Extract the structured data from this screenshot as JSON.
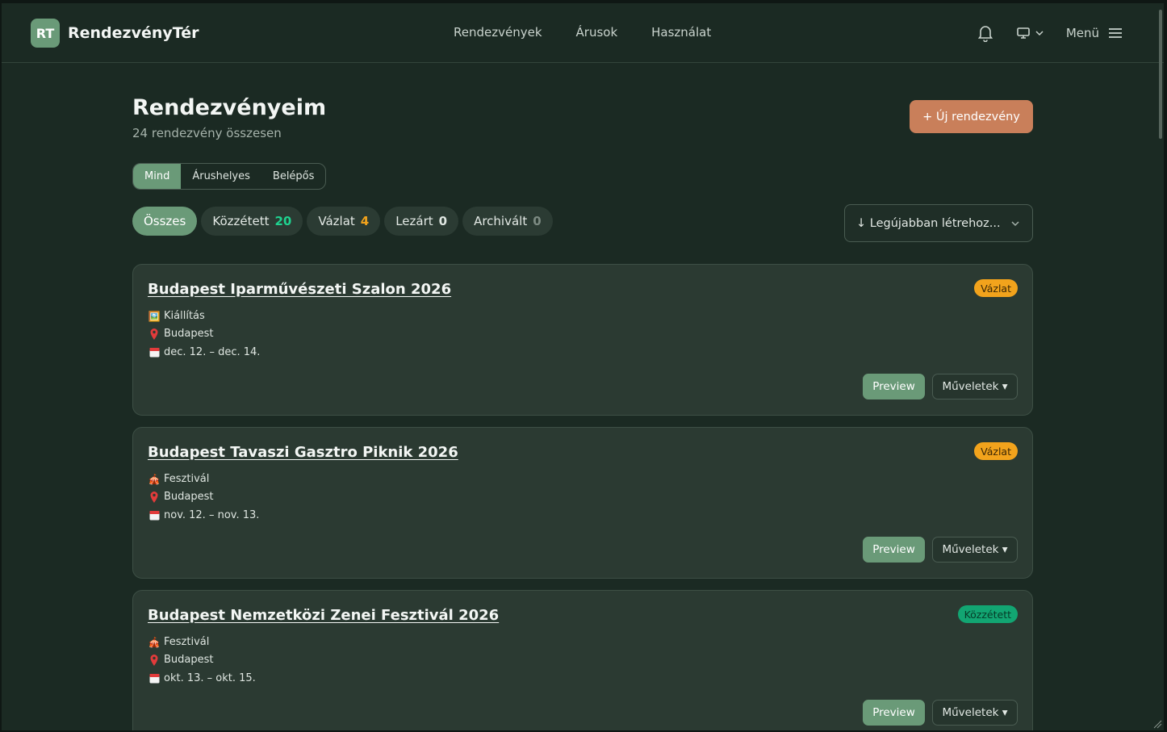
{
  "app": {
    "logo_badge": "RT",
    "name": "RendezvényTér"
  },
  "nav": [
    "Rendezvények",
    "Árusok",
    "Használat"
  ],
  "header": {
    "menu_label": "Menü"
  },
  "page": {
    "title": "Rendezvényeim",
    "subtitle": "24 rendezvény összesen",
    "new_button": "+ Új rendezvény"
  },
  "segments": [
    "Mind",
    "Árushelyes",
    "Belépős"
  ],
  "filters": [
    {
      "label": "Összes",
      "count": "",
      "color": ""
    },
    {
      "label": "Közzétett",
      "count": "20",
      "color": "#1fd28f"
    },
    {
      "label": "Vázlat",
      "count": "4",
      "color": "#f2a31c"
    },
    {
      "label": "Lezárt",
      "count": "0",
      "color": "#dfe6e1"
    },
    {
      "label": "Archivált",
      "count": "0",
      "color": "#7c8a82"
    }
  ],
  "sort": {
    "label": "↓ Legújabban létrehoz..."
  },
  "events": [
    {
      "title": "Budapest Iparművészeti Szalon 2026",
      "status": "Vázlat",
      "status_kind": "draft",
      "type_icon": "🖼️",
      "type": "Kiállítás",
      "city": "Budapest",
      "dates": "dec. 12. – dec. 14.",
      "preview": "Preview",
      "actions": "Műveletek ▾"
    },
    {
      "title": "Budapest Tavaszi Gasztro Piknik 2026",
      "status": "Vázlat",
      "status_kind": "draft",
      "type_icon": "🎪",
      "type": "Fesztivál",
      "city": "Budapest",
      "dates": "nov. 12. – nov. 13.",
      "preview": "Preview",
      "actions": "Műveletek ▾"
    },
    {
      "title": "Budapest Nemzetközi Zenei Fesztivál 2026",
      "status": "Közzétett",
      "status_kind": "pub",
      "type_icon": "🎪",
      "type": "Fesztivál",
      "city": "Budapest",
      "dates": "okt. 13. – okt. 15.",
      "preview": "Preview",
      "actions": "Műveletek ▾"
    }
  ]
}
